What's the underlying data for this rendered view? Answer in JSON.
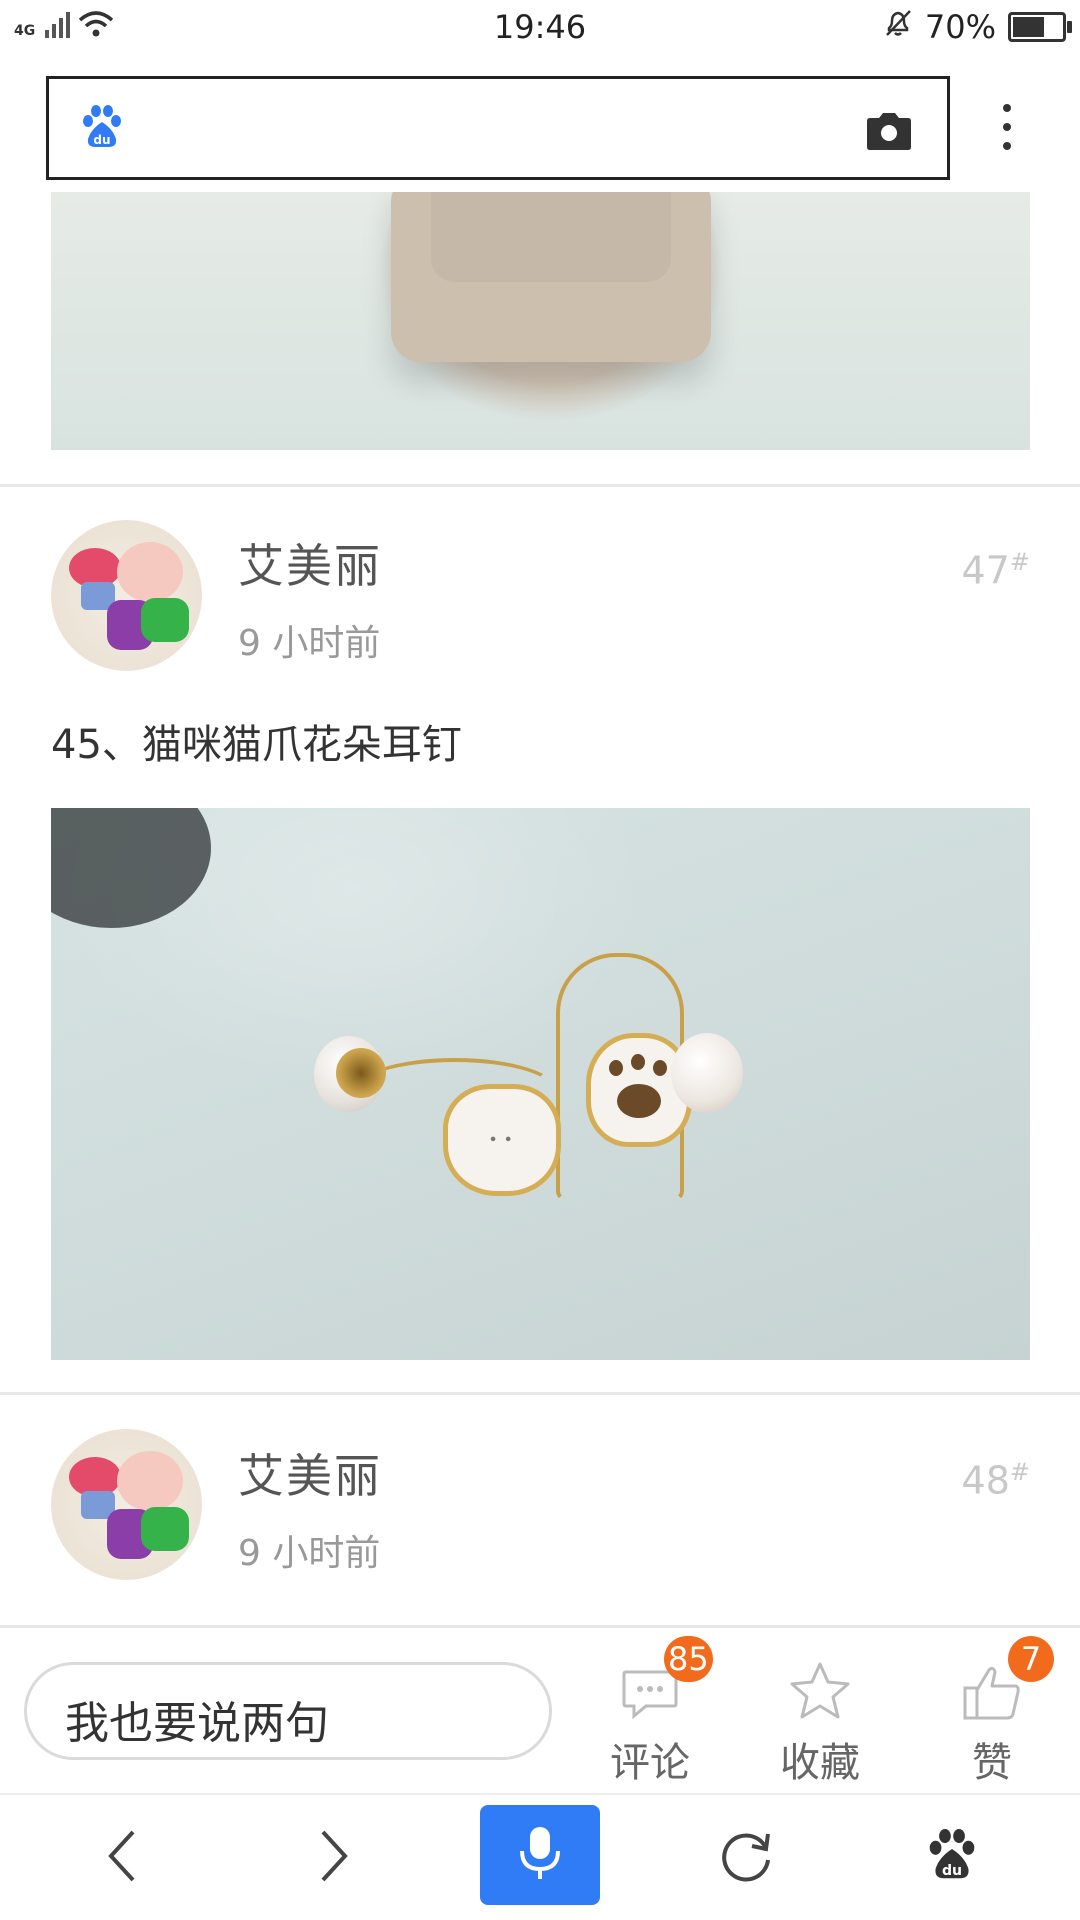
{
  "status_bar": {
    "network": "4G",
    "time": "19:46",
    "battery": "70%",
    "battery_level": 0.7
  },
  "posts": [
    {
      "username": "艾美丽",
      "time": "9 小时前",
      "floor": "47",
      "floor_mark": "#",
      "text": "45、猫咪猫爪花朵耳钉"
    },
    {
      "username": "艾美丽",
      "time": "9 小时前",
      "floor": "48",
      "floor_mark": "#"
    }
  ],
  "comment_bar": {
    "placeholder": "我也要说两句",
    "comment_label": "评论",
    "comment_count": "85",
    "favorite_label": "收藏",
    "like_label": "赞",
    "like_count": "7"
  },
  "colors": {
    "accent": "#2f7cf6",
    "badge": "#f26a1b"
  }
}
